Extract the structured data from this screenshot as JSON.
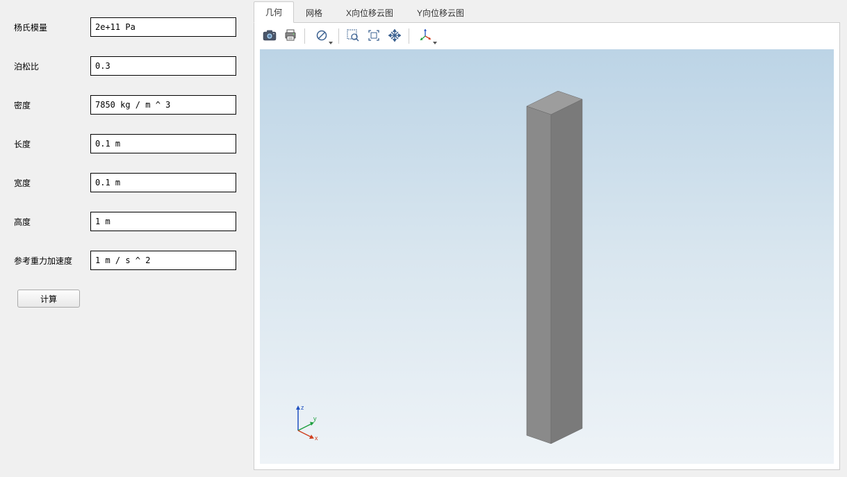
{
  "form": {
    "fields": [
      {
        "label": "杨氏模量",
        "value": "2e+11 Pa"
      },
      {
        "label": "泊松比",
        "value": "0.3"
      },
      {
        "label": "密度",
        "value": "7850 kg / m ^ 3"
      },
      {
        "label": "长度",
        "value": "0.1 m"
      },
      {
        "label": "宽度",
        "value": "0.1 m"
      },
      {
        "label": "高度",
        "value": "1 m"
      },
      {
        "label": "参考重力加速度",
        "value": "1 m / s ^ 2"
      }
    ],
    "compute_label": "计算"
  },
  "tabs": {
    "items": [
      {
        "label": "几何",
        "active": true
      },
      {
        "label": "网格",
        "active": false
      },
      {
        "label": "X向位移云图",
        "active": false
      },
      {
        "label": "Y向位移云图",
        "active": false
      }
    ]
  },
  "toolbar": {
    "icons": [
      "camera-icon",
      "print-icon",
      "|",
      "no-entry-icon",
      "|",
      "zoom-box-icon",
      "fit-icon",
      "cross-arrows-icon",
      "|",
      "axis-gizmo-icon"
    ]
  },
  "axis": {
    "x": "x",
    "y": "y",
    "z": "z"
  }
}
